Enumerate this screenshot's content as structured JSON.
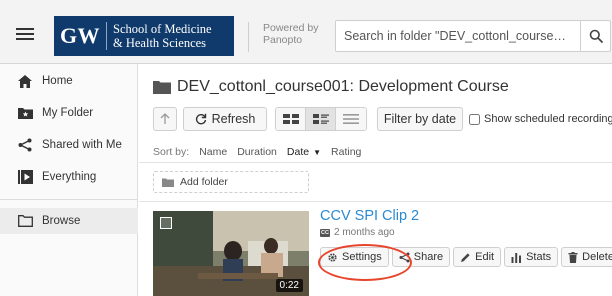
{
  "header": {
    "logo_mark": "GW",
    "logo_line1": "School of Medicine",
    "logo_line2": "& Health Sciences",
    "powered_line1": "Powered by",
    "powered_line2": "Panopto",
    "search_placeholder": "Search in folder \"DEV_cottonl_course…"
  },
  "sidebar": {
    "items": [
      {
        "label": "Home",
        "icon": "home-icon"
      },
      {
        "label": "My Folder",
        "icon": "folder-star-icon"
      },
      {
        "label": "Shared with Me",
        "icon": "share-icon"
      },
      {
        "label": "Everything",
        "icon": "play-icon"
      },
      {
        "label": "Browse",
        "icon": "folder-icon"
      }
    ]
  },
  "main": {
    "folder_title": "DEV_cottonl_course001: Development Course",
    "toolbar": {
      "refresh_label": "Refresh",
      "filter_label": "Filter by date",
      "scheduled_label": "Show scheduled recordings"
    },
    "sort": {
      "label": "Sort by:",
      "options": [
        "Name",
        "Duration",
        "Date",
        "Rating"
      ],
      "active": "Date"
    },
    "add_folder_label": "Add folder",
    "session": {
      "title": "CCV SPI Clip 2",
      "cc_badge": "CC",
      "age": "2 months ago",
      "duration": "0:22",
      "actions": [
        "Settings",
        "Share",
        "Edit",
        "Stats",
        "Delete"
      ]
    }
  },
  "colors": {
    "brand_navy": "#0f3a6b",
    "link_blue": "#2b8ad2",
    "highlight_red": "#e8452c"
  }
}
